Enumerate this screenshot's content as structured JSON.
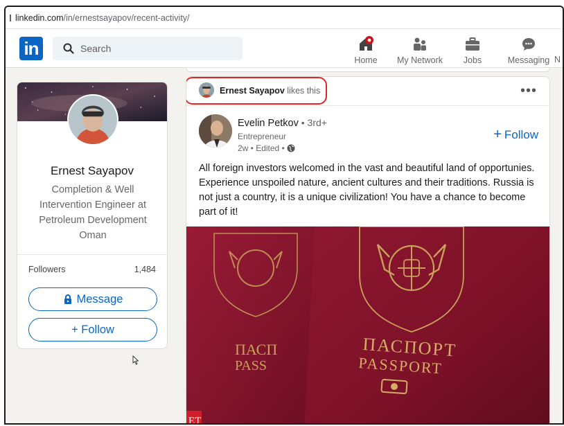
{
  "browser": {
    "url_host": "linkedin.com",
    "url_path": "/in/ernestsayapov/recent-activity/"
  },
  "nav": {
    "logo_text": "in",
    "search_placeholder": "Search",
    "items": [
      {
        "label": "Home"
      },
      {
        "label": "My Network"
      },
      {
        "label": "Jobs"
      },
      {
        "label": "Messaging"
      }
    ],
    "cut_label": "N",
    "accent": "#0a66c2",
    "badge_color": "#cc1016"
  },
  "profile": {
    "name": "Ernest Sayapov",
    "headline": "Completion & Well Intervention Engineer at Petroleum Development Oman",
    "followers_label": "Followers",
    "followers_count": "1,484",
    "message_label": "Message",
    "follow_label": "+ Follow"
  },
  "post": {
    "liked_by": "Ernest Sayapov",
    "liked_suffix": "likes this",
    "more_label": "•••",
    "author": {
      "name": "Evelin Petkov",
      "degree": " • 3rd+",
      "title": "Entrepreneur",
      "meta": "2w • Edited •"
    },
    "follow_label": "Follow",
    "text": "All foreign investors welcomed in the vast and beautiful land of opportunies. Experience unspoiled nature, ancient cultures and their traditions. Russia is not just a country, it is a unique civilization! You have a chance to become part of it!",
    "image": {
      "passport_ru": "ПАСПОРТ",
      "passport_en": "PASSPORT",
      "back_ru": "ПАСП",
      "back_en": "PASS",
      "watermark": "ET"
    }
  },
  "colors": {
    "highlight": "#e02424",
    "passport": "#7c1128"
  }
}
